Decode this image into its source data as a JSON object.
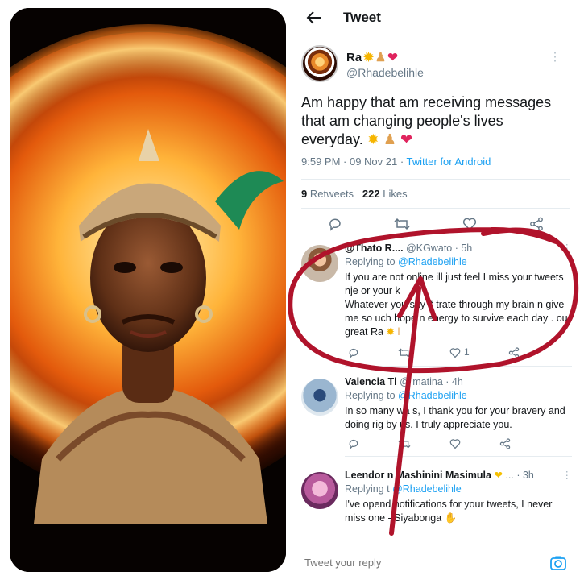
{
  "topbar": {
    "title": "Tweet",
    "back_icon": "arrow-left-icon"
  },
  "tweet": {
    "author_name": "Ra",
    "author_emojis": [
      "sun-emoji",
      "meditation-emoji",
      "heart-emoji"
    ],
    "author_handle": "@Rhadebelihle",
    "text": "Am happy that am receiving messages that am changing people's lives everyday.",
    "meta_time": "9:59 PM · 09 Nov 21 · ",
    "meta_source": "Twitter for Android",
    "retweets_count": "9",
    "retweets_label": "Retweets",
    "likes_count": "222",
    "likes_label": "Likes"
  },
  "replies": [
    {
      "name": "@Thato R....",
      "handle": "@KGwato · 5h",
      "replying_to_label": "Replying to",
      "replying_to": "@Rhadebelihle",
      "text_1": "If you are not online ill just feel I miss your tweets nje or your",
      "text_2": "k",
      "text_3": "Whatever you say it",
      "text_4": "trate through my brain n give me so",
      "text_5": "uch hope n energy to survive each day .",
      "text_6": "ou great Ra",
      "like_count": "1"
    },
    {
      "name": "Valencia Tl",
      "handle": "@ matina · 4h",
      "replying_to_label": "Replying to",
      "replying_to": "@Rhadebelihle",
      "text": "In so many wa s, I thank you for your bravery and doing rig by us. I truly appreciate you."
    },
    {
      "name": "Leendor n Mashinini Masimula",
      "handle": "... · 3h",
      "replying_to_label": "Replying t",
      "replying_to": "@Rhadebelihle",
      "text": "I've opend notifications for your tweets, I never miss one - Siyabonga"
    }
  ],
  "reply_box": {
    "placeholder": "Tweet your reply"
  },
  "colors": {
    "link": "#1da1f2",
    "annotation": "#b0132b",
    "muted": "#657786"
  }
}
